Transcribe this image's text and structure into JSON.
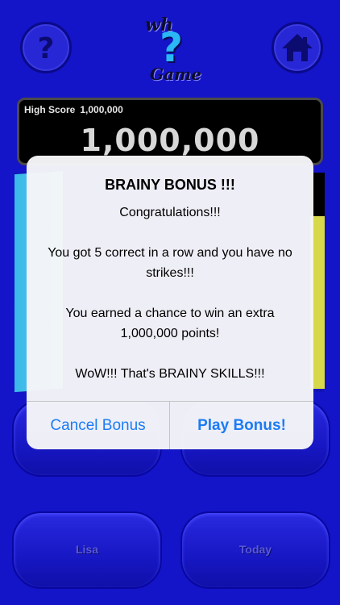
{
  "header": {
    "help_icon": "question-circle-icon",
    "home_icon": "home-icon",
    "logo": {
      "top": "wh",
      "mark": "?",
      "bottom": "Game"
    }
  },
  "score": {
    "high_score_label": "High Score",
    "high_score_value": "1,000,000",
    "current_score": "1,000,000"
  },
  "bottom_buttons": {
    "left_label": "Lisa",
    "right_label": "Today"
  },
  "alert": {
    "title": "BRAINY BONUS !!!",
    "line1": "Congratulations!!!",
    "line2": "You got 5 correct in a row and you have no strikes!!!",
    "line3": "You earned a chance to win an extra 1,000,000 points!",
    "line4": "WoW!!! That's BRAINY SKILLS!!!",
    "cancel_label": "Cancel Bonus",
    "play_label": "Play Bonus!"
  },
  "colors": {
    "background": "#1414c8",
    "alert_button": "#1a7cf5",
    "logo_mark": "#29b7f5"
  }
}
